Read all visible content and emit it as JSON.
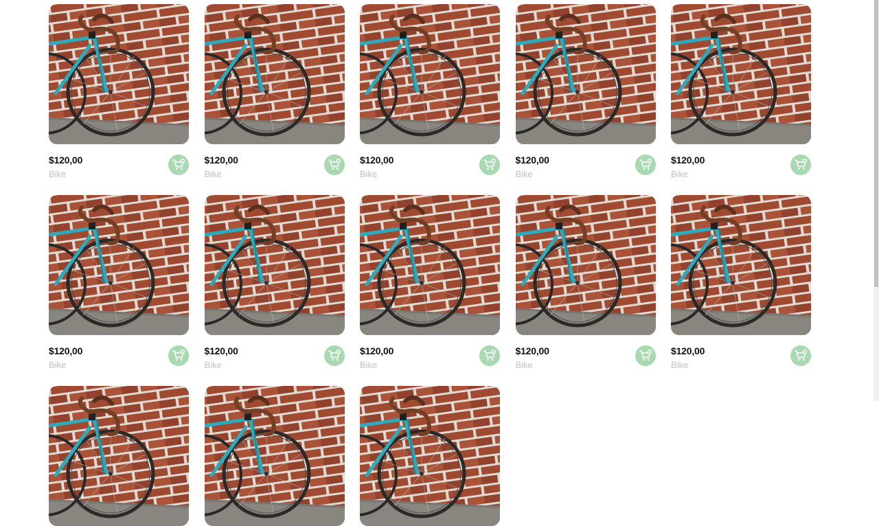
{
  "products": [
    {
      "price": "$120,00",
      "name": "Bike"
    },
    {
      "price": "$120,00",
      "name": "Bike"
    },
    {
      "price": "$120,00",
      "name": "Bike"
    },
    {
      "price": "$120,00",
      "name": "Bike"
    },
    {
      "price": "$120,00",
      "name": "Bike"
    },
    {
      "price": "$120,00",
      "name": "Bike"
    },
    {
      "price": "$120,00",
      "name": "Bike"
    },
    {
      "price": "$120,00",
      "name": "Bike"
    },
    {
      "price": "$120,00",
      "name": "Bike"
    },
    {
      "price": "$120,00",
      "name": "Bike"
    },
    {
      "price": "",
      "name": ""
    },
    {
      "price": "",
      "name": ""
    },
    {
      "price": "",
      "name": ""
    }
  ],
  "icons": {
    "cart": "add-to-cart-icon",
    "image": "bike-photo"
  },
  "colors": {
    "accent": "#a8d9b0",
    "price": "#111111",
    "muted": "#c2c2c2"
  }
}
